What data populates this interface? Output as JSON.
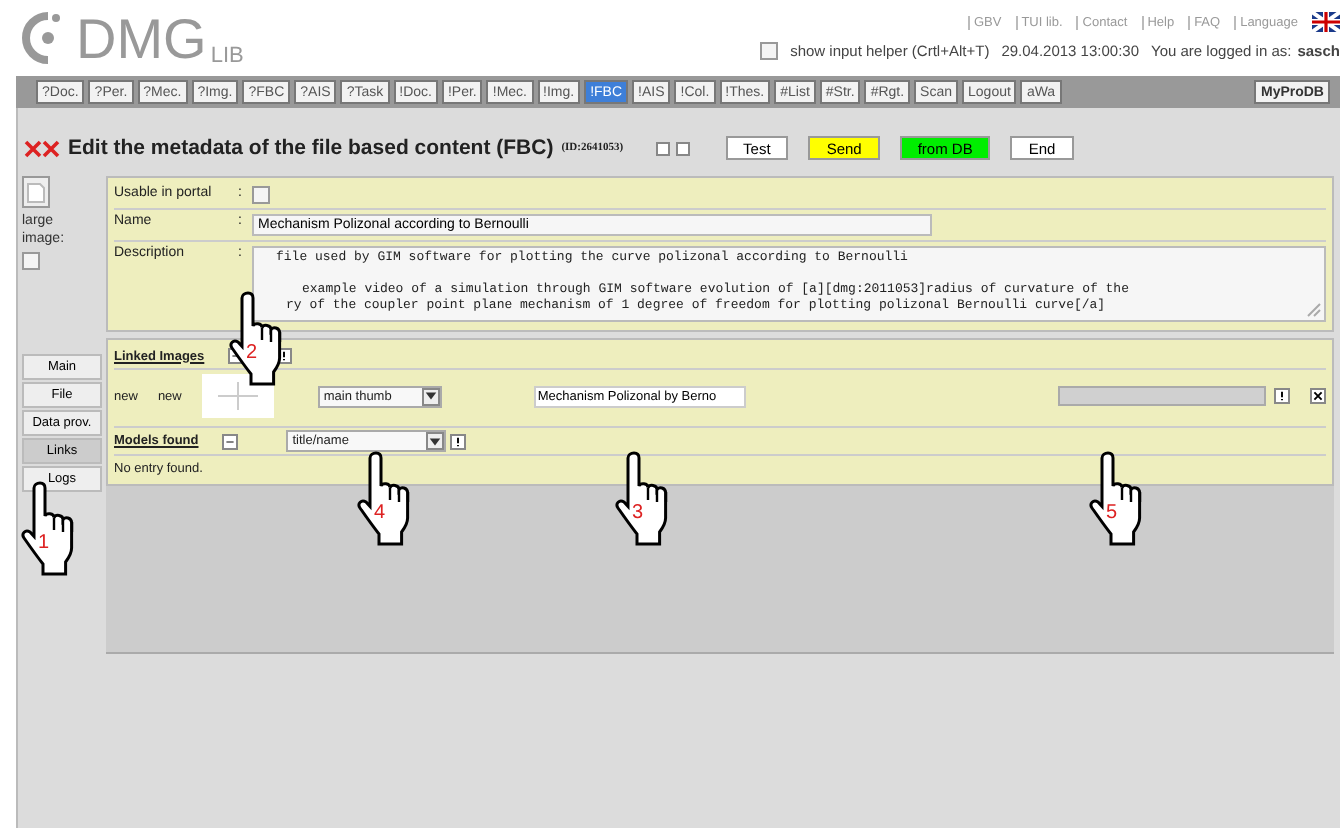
{
  "header": {
    "logo": {
      "main": "DMG",
      "sub": "LIB"
    },
    "top_links": [
      "GBV",
      "TUI lib.",
      "Contact",
      "Help",
      "FAQ",
      "Language"
    ],
    "input_helper": {
      "label": "show input helper (Crtl+Alt+T)",
      "checked": false
    },
    "datetime": "29.04.2013 13:00:30",
    "login_prefix": "You are logged in as:",
    "user": "sasch"
  },
  "nav": [
    {
      "label": "?Doc.",
      "selected": false
    },
    {
      "label": "?Per.",
      "selected": false
    },
    {
      "label": "?Mec.",
      "selected": false
    },
    {
      "label": "?Img.",
      "selected": false
    },
    {
      "label": "?FBC",
      "selected": false
    },
    {
      "label": "?AIS",
      "selected": false
    },
    {
      "label": "?Task",
      "selected": false
    },
    {
      "label": "!Doc.",
      "selected": false
    },
    {
      "label": "!Per.",
      "selected": false
    },
    {
      "label": "!Mec.",
      "selected": false
    },
    {
      "label": "!Img.",
      "selected": false
    },
    {
      "label": "!FBC",
      "selected": true
    },
    {
      "label": "!AIS",
      "selected": false
    },
    {
      "label": "!Col.",
      "selected": false
    },
    {
      "label": "!Thes.",
      "selected": false
    },
    {
      "label": "#List",
      "selected": false
    },
    {
      "label": "#Str.",
      "selected": false
    },
    {
      "label": "#Rgt.",
      "selected": false
    },
    {
      "label": "Scan",
      "selected": false
    },
    {
      "label": "Logout",
      "selected": false
    },
    {
      "label": "aWa",
      "selected": false
    }
  ],
  "nav_right": "MyProDB",
  "title": {
    "text": "Edit the metadata of the file based content (FBC)",
    "id": "(ID:2641053)",
    "buttons": [
      {
        "label": "Test",
        "kind": "plain"
      },
      {
        "label": "Send",
        "kind": "yellow"
      },
      {
        "label": "from DB",
        "kind": "green"
      },
      {
        "label": "End",
        "kind": "plain"
      }
    ]
  },
  "large_image": {
    "label": "large image:",
    "checked": false
  },
  "form": {
    "usable": {
      "label": "Usable in portal",
      "separator": ":",
      "checked": false
    },
    "name": {
      "label": "Name",
      "separator": ":",
      "value": "Mechanism Polizonal according to Bernoulli"
    },
    "description": {
      "label": "Description",
      "separator": ":",
      "lines": [
        "file used by GIM software for plotting the curve polizonal according to Bernoulli",
        "example video of a simulation through GIM software evolution of [a][dmg:2011053]radius of curvature of the",
        "ry of the coupler point plane mechanism of 1 degree of freedom for plotting polizonal Bernoulli curve[/a]"
      ]
    }
  },
  "side_tabs": [
    {
      "label": "Main",
      "selected": false
    },
    {
      "label": "File",
      "selected": false
    },
    {
      "label": "Data prov.",
      "selected": false
    },
    {
      "label": "Links",
      "selected": true
    },
    {
      "label": "Logs",
      "selected": false
    }
  ],
  "linked_images": {
    "title": "Linked Images",
    "row": {
      "column_1": "new",
      "column_2": "new",
      "role": "main thumb",
      "caption": "Mechanism Polizonal by Berno"
    }
  },
  "models_found": {
    "title": "Models found",
    "filter": "title/name",
    "message": "No entry found."
  },
  "callouts": [
    {
      "number": "2"
    },
    {
      "number": "1"
    },
    {
      "number": "4"
    },
    {
      "number": "3"
    },
    {
      "number": "5"
    }
  ]
}
